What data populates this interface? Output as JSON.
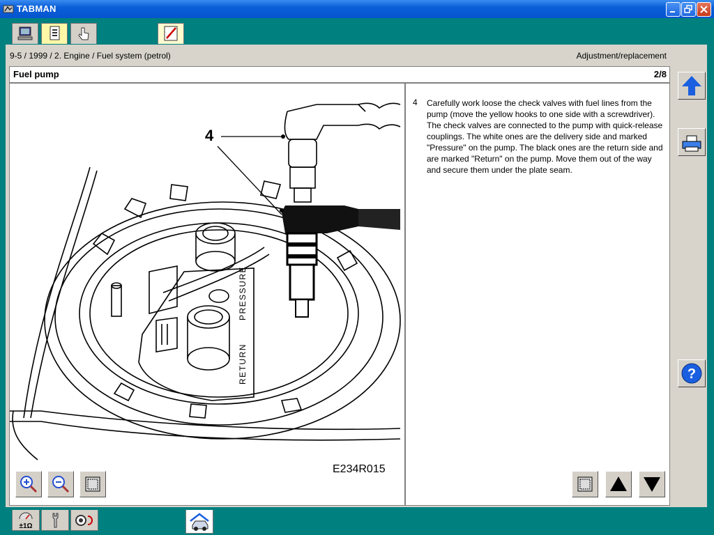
{
  "window": {
    "title": "TABMAN"
  },
  "tabs": [
    {
      "icon": "computer-icon"
    },
    {
      "icon": "document-list-icon"
    },
    {
      "icon": "hand-pointer-icon"
    },
    {
      "icon": "pen-icon",
      "active": true
    }
  ],
  "breadcrumb": "9-5 / 1999 / 2. Engine / Fuel system (petrol)",
  "mode": "Adjustment/replacement",
  "panel": {
    "title": "Fuel pump",
    "page": "2/8"
  },
  "figure": {
    "code": "E234R015",
    "callout": "4",
    "labels": {
      "pressure": "PRESSURE",
      "return": "RETURN"
    }
  },
  "step": {
    "number": "4",
    "text": "Carefully work loose the check valves with fuel lines from the pump (move the yellow hooks to one side with a screwdriver). The check valves are connected to the pump with quick-release couplings. The white ones are the delivery side and marked \"Pressure\" on the pump. The black ones are the return side and are marked \"Return\" on the pump. Move them out of the way and secure them under the plate seam."
  },
  "figure_tools": [
    "zoom-in-icon",
    "zoom-out-icon",
    "fit-frame-icon"
  ],
  "text_tools": [
    "fit-frame-icon",
    "page-up-icon",
    "page-down-icon"
  ],
  "sidebar": [
    "navigate-up-icon",
    "print-icon",
    "help-icon"
  ],
  "sidebar_labels": {
    "help": "?"
  },
  "bottom_tabs": [
    {
      "icon": "meter-icon",
      "label": "±1Ω"
    },
    {
      "icon": "wrench-icon"
    },
    {
      "icon": "diagnostic-icon"
    },
    {
      "icon": "car-home-icon",
      "active": true
    }
  ],
  "colors": {
    "accent_blue": "#1a5fe0",
    "teal": "#00807f"
  }
}
